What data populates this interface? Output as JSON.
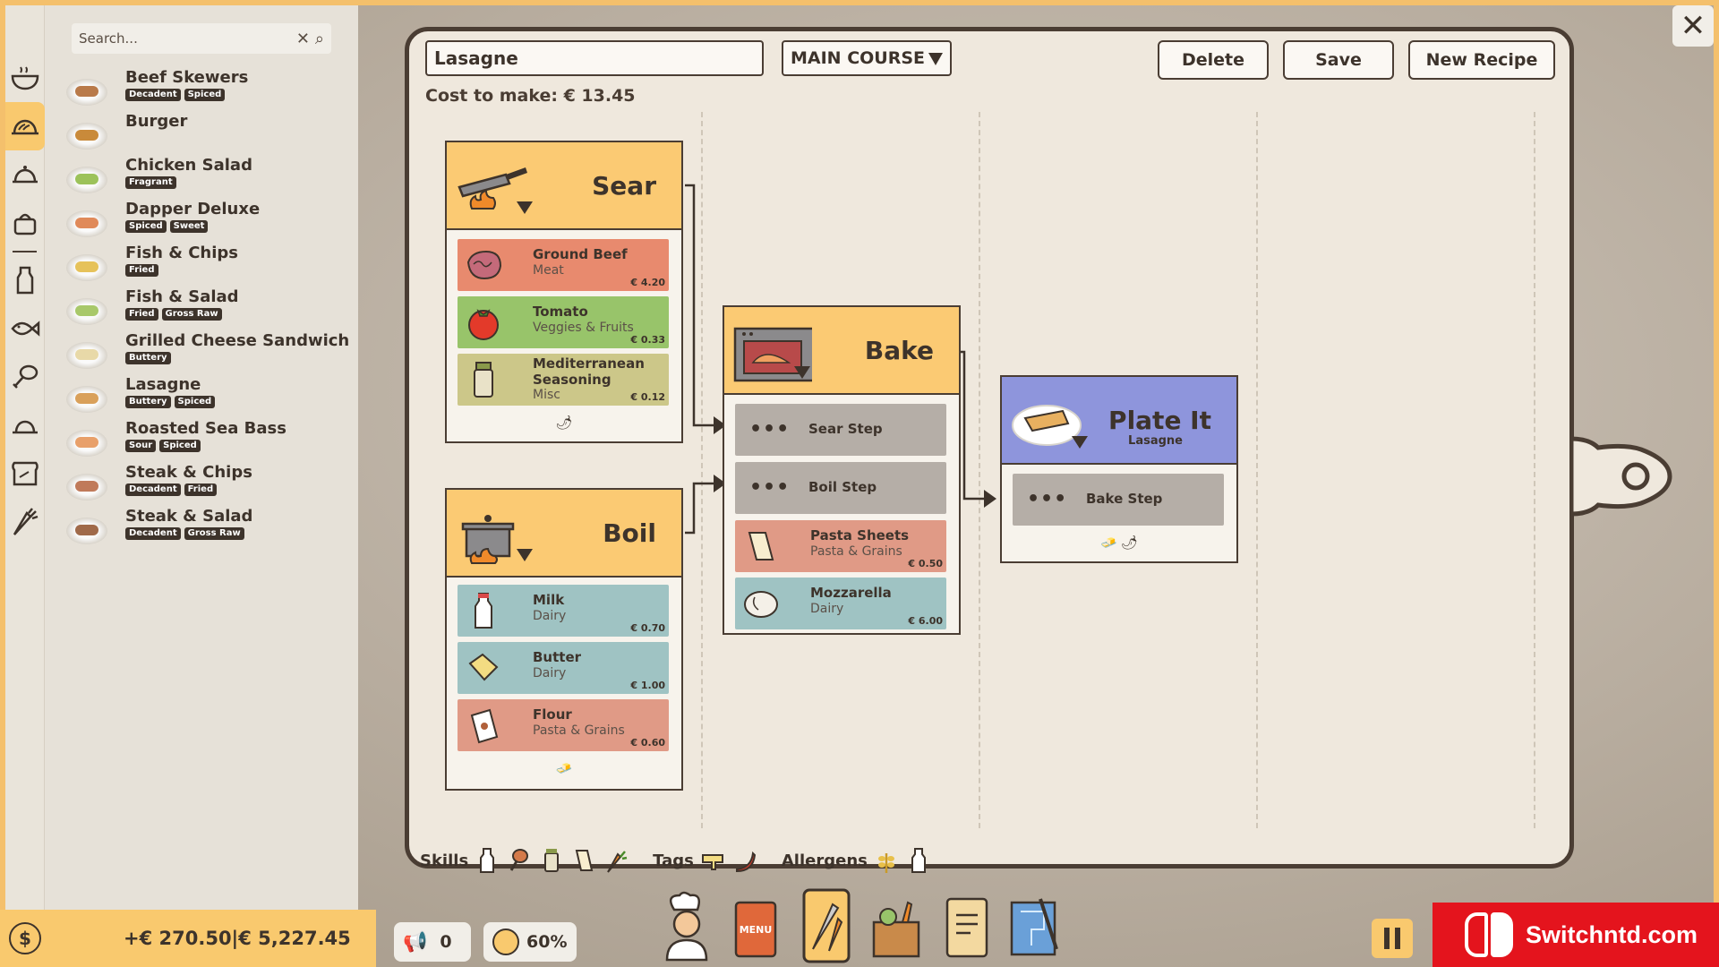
{
  "search": {
    "placeholder": "Search..."
  },
  "recipes": [
    {
      "name": "Beef Skewers",
      "tags": [
        "Decadent",
        "Spiced"
      ],
      "color": "#b97a4a"
    },
    {
      "name": "Burger",
      "tags": [],
      "color": "#c98a3a"
    },
    {
      "name": "Chicken Salad",
      "tags": [
        "Fragrant"
      ],
      "color": "#9cc25a"
    },
    {
      "name": "Dapper Deluxe",
      "tags": [
        "Spiced",
        "Sweet"
      ],
      "color": "#e08a5a"
    },
    {
      "name": "Fish & Chips",
      "tags": [
        "Fried"
      ],
      "color": "#e6c25a"
    },
    {
      "name": "Fish & Salad",
      "tags": [
        "Fried",
        "Gross Raw"
      ],
      "color": "#a8c86a"
    },
    {
      "name": "Grilled Cheese Sandwich",
      "tags": [
        "Buttery"
      ],
      "color": "#e8d9a8"
    },
    {
      "name": "Lasagne",
      "tags": [
        "Buttery",
        "Spiced"
      ],
      "color": "#d9a05a"
    },
    {
      "name": "Roasted Sea Bass",
      "tags": [
        "Sour",
        "Spiced"
      ],
      "color": "#e8a06a"
    },
    {
      "name": "Steak & Chips",
      "tags": [
        "Decadent",
        "Fried"
      ],
      "color": "#c07a5a"
    },
    {
      "name": "Steak & Salad",
      "tags": [
        "Decadent",
        "Gross Raw"
      ],
      "color": "#a06a4a"
    }
  ],
  "money": {
    "text": "+€ 270.50|€ 5,227.45",
    "symbol": "$"
  },
  "editor": {
    "recipe_name": "Lasagne",
    "course": "MAIN COURSE",
    "delete_label": "Delete",
    "save_label": "Save",
    "new_label": "New Recipe",
    "cost": "Cost to make: € 13.45"
  },
  "steps": {
    "sear": {
      "title": "Sear",
      "ingredients": [
        {
          "name": "Ground Beef",
          "category": "Meat",
          "price": "€ 4.20"
        },
        {
          "name": "Tomato",
          "category": "Veggies & Fruits",
          "price": "€ 0.33"
        },
        {
          "name": "Mediterranean Seasoning",
          "name_l1": "Mediterranean",
          "name_l2": "Seasoning",
          "category": "Misc",
          "price": "€ 0.12"
        }
      ]
    },
    "boil": {
      "title": "Boil",
      "ingredients": [
        {
          "name": "Milk",
          "category": "Dairy",
          "price": "€ 0.70"
        },
        {
          "name": "Butter",
          "category": "Dairy",
          "price": "€ 1.00"
        },
        {
          "name": "Flour",
          "category": "Pasta & Grains",
          "price": "€ 0.60"
        }
      ]
    },
    "bake": {
      "title": "Bake",
      "inputs": [
        "Sear Step",
        "Boil Step"
      ],
      "ingredients": [
        {
          "name": "Pasta Sheets",
          "category": "Pasta & Grains",
          "price": "€ 0.50"
        },
        {
          "name": "Mozzarella",
          "category": "Dairy",
          "price": "€ 6.00"
        }
      ]
    },
    "plate": {
      "title": "Plate It",
      "subtitle": "Lasagne",
      "inputs": [
        "Bake Step"
      ]
    }
  },
  "summary": {
    "skills_label": "Skills",
    "tags_label": "Tags",
    "allergens_label": "Allergens"
  },
  "toolbar": {
    "marketing": "0",
    "satisfaction": "60%"
  },
  "brand": {
    "text": "Switchntd.com"
  },
  "colors": {
    "accent": "#f9c96e",
    "board_border": "#4a3d33",
    "plate_header": "#8e95dc",
    "brand": "#e4141d"
  }
}
